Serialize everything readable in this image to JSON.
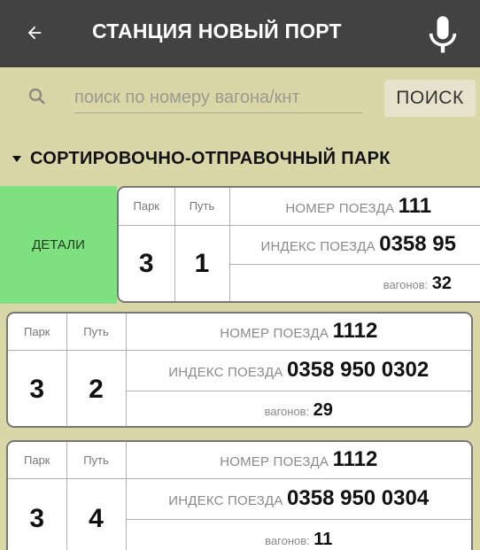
{
  "header": {
    "title": "СТАНЦИЯ НОВЫЙ ПОРТ",
    "back_icon": "arrow-left-icon",
    "mic_icon": "microphone-icon"
  },
  "search": {
    "placeholder": "поиск по номеру вагона/кнт",
    "button_label": "ПОИСК",
    "icon": "search-icon"
  },
  "section": {
    "title": "СОРТИРОВОЧНО-ОТПРАВОЧНЫЙ ПАРК",
    "expanded": true
  },
  "details_label": "ДЕТАЛИ",
  "labels": {
    "park": "Парк",
    "track": "Путь",
    "train_number": "НОМЕР ПОЕЗДА",
    "train_index": "ИНДЕКС ПОЕЗДА",
    "wagons": "вагонов:"
  },
  "trains": [
    {
      "park": "3",
      "track": "1",
      "number": "111",
      "index": "0358 95",
      "wagons": "32"
    },
    {
      "park": "3",
      "track": "2",
      "number": "1112",
      "index": "0358 950 0302",
      "wagons": "29"
    },
    {
      "park": "3",
      "track": "4",
      "number": "1112",
      "index": "0358 950 0304",
      "wagons": "11"
    }
  ],
  "colors": {
    "appbar": "#424242",
    "search_background": "#d9d6a8",
    "details_green": "#7ee07f"
  }
}
